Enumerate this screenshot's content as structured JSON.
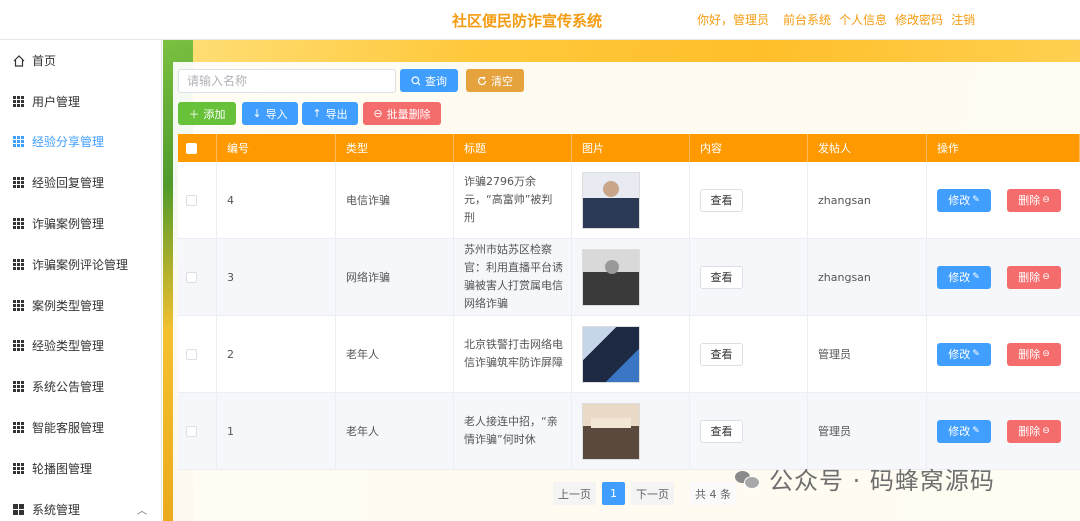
{
  "header": {
    "title": "社区便民防诈宣传系统",
    "greeting": "你好，管理员",
    "links": [
      "前台系统",
      "个人信息",
      "修改密码",
      "注销"
    ]
  },
  "sidebar": {
    "items": [
      {
        "label": "首页",
        "icon": "home-icon"
      },
      {
        "label": "用户管理",
        "icon": "grid-icon"
      },
      {
        "label": "经验分享管理",
        "icon": "grid-icon",
        "active": true
      },
      {
        "label": "经验回复管理",
        "icon": "grid-icon"
      },
      {
        "label": "诈骗案例管理",
        "icon": "grid-icon"
      },
      {
        "label": "诈骗案例评论管理",
        "icon": "grid-icon"
      },
      {
        "label": "案例类型管理",
        "icon": "grid-icon"
      },
      {
        "label": "经验类型管理",
        "icon": "grid-icon"
      },
      {
        "label": "系统公告管理",
        "icon": "grid-icon"
      },
      {
        "label": "智能客服管理",
        "icon": "grid-icon"
      },
      {
        "label": "轮播图管理",
        "icon": "grid-icon"
      },
      {
        "label": "系统管理",
        "icon": "apps-icon",
        "expandable": true
      }
    ]
  },
  "toolbar": {
    "search_placeholder": "请输入名称",
    "query_label": "查询",
    "clear_label": "清空",
    "add_label": "添加",
    "import_label": "导入",
    "export_label": "导出",
    "batch_delete_label": "批量删除"
  },
  "table": {
    "columns": [
      "编号",
      "类型",
      "标题",
      "图片",
      "内容",
      "发帖人",
      "操作"
    ],
    "view_label": "查看",
    "edit_label": "修改",
    "delete_label": "删除",
    "rows": [
      {
        "id": "4",
        "type": "电信诈骗",
        "title": "诈骗2796万余元，“高富帅”被判刑",
        "poster": "zhangsan"
      },
      {
        "id": "3",
        "type": "网络诈骗",
        "title": "苏州市姑苏区检察官：利用直播平台诱骗被害人打赏属电信网络诈骗",
        "poster": "zhangsan"
      },
      {
        "id": "2",
        "type": "老年人",
        "title": "北京铁警打击网络电信诈骗筑牢防诈屏障",
        "poster": "管理员"
      },
      {
        "id": "1",
        "type": "老年人",
        "title": "老人接连中招，“亲情诈骗”何时休",
        "poster": "管理员"
      }
    ]
  },
  "pagination": {
    "prev_label": "上一页",
    "current_page": "1",
    "next_label": "下一页",
    "total_label": "共 4 条"
  },
  "watermark": {
    "text": "公众号 · 码蜂窝源码"
  },
  "colors": {
    "accent": "#f39c12",
    "primary": "#409eff",
    "success": "#67c23a",
    "warning": "#e6a23c",
    "danger": "#f56c6c",
    "table_header": "#ff9900"
  }
}
